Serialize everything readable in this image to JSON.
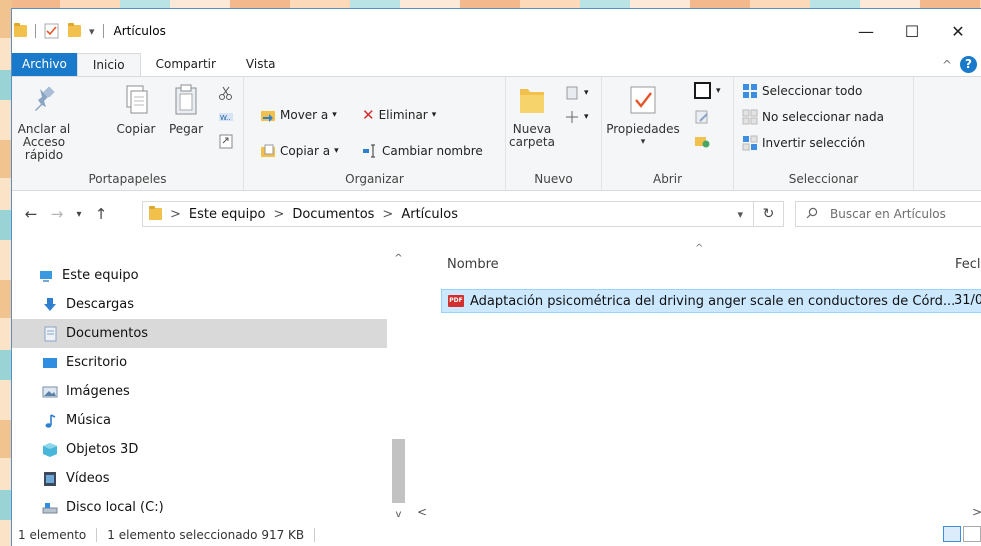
{
  "window": {
    "title": "Artículos",
    "controls": {
      "minimize": "—",
      "maximize": "☐",
      "close": "✕"
    }
  },
  "ribbon_tabs": [
    "Archivo",
    "Inicio",
    "Compartir",
    "Vista"
  ],
  "help": {
    "label": "?",
    "collapse_glyph": "^"
  },
  "ribbon": {
    "portapapeles": {
      "label": "Portapapeles",
      "anclar_line1": "Anclar al",
      "anclar_line2": "Acceso rápido",
      "copiar": "Copiar",
      "pegar": "Pegar"
    },
    "organizar": {
      "label": "Organizar",
      "mover": "Mover a",
      "copiar_a": "Copiar a",
      "eliminar": "Eliminar",
      "cambiar_nombre": "Cambiar nombre"
    },
    "nuevo": {
      "label": "Nuevo",
      "nueva_line1": "Nueva",
      "nueva_line2": "carpeta"
    },
    "abrir": {
      "label": "Abrir",
      "propiedades": "Propiedades"
    },
    "seleccionar": {
      "label": "Seleccionar",
      "todo": "Seleccionar todo",
      "nada": "No seleccionar nada",
      "invertir": "Invertir selección"
    }
  },
  "address": {
    "crumbs": [
      "Este equipo",
      "Documentos",
      "Artículos"
    ],
    "separator": ">",
    "search_placeholder": "Buscar en Artículos"
  },
  "nav": {
    "items": [
      {
        "label": "Este equipo",
        "icon": "computer-icon"
      },
      {
        "label": "Descargas",
        "icon": "download-icon"
      },
      {
        "label": "Documentos",
        "icon": "documents-icon",
        "selected": true
      },
      {
        "label": "Escritorio",
        "icon": "desktop-icon"
      },
      {
        "label": "Imágenes",
        "icon": "pictures-icon"
      },
      {
        "label": "Música",
        "icon": "music-icon"
      },
      {
        "label": "Objetos 3D",
        "icon": "3d-objects-icon"
      },
      {
        "label": "Vídeos",
        "icon": "videos-icon"
      },
      {
        "label": "Disco local (C:)",
        "icon": "drive-icon"
      }
    ]
  },
  "columns": {
    "name": "Nombre",
    "date": "Fecl"
  },
  "files": [
    {
      "name": "Adaptación psicométrica del driving anger scale en conductores de Córd...",
      "date": "31/0",
      "icon": "pdf-icon",
      "selected": true
    }
  ],
  "status": {
    "count": "1 elemento",
    "selection": "1 elemento seleccionado  917 KB"
  },
  "colors": {
    "accent": "#1979ca",
    "selection_bg": "#cce8ff",
    "selection_border": "#99d1ff",
    "nav_selected": "#d9d9d9"
  }
}
